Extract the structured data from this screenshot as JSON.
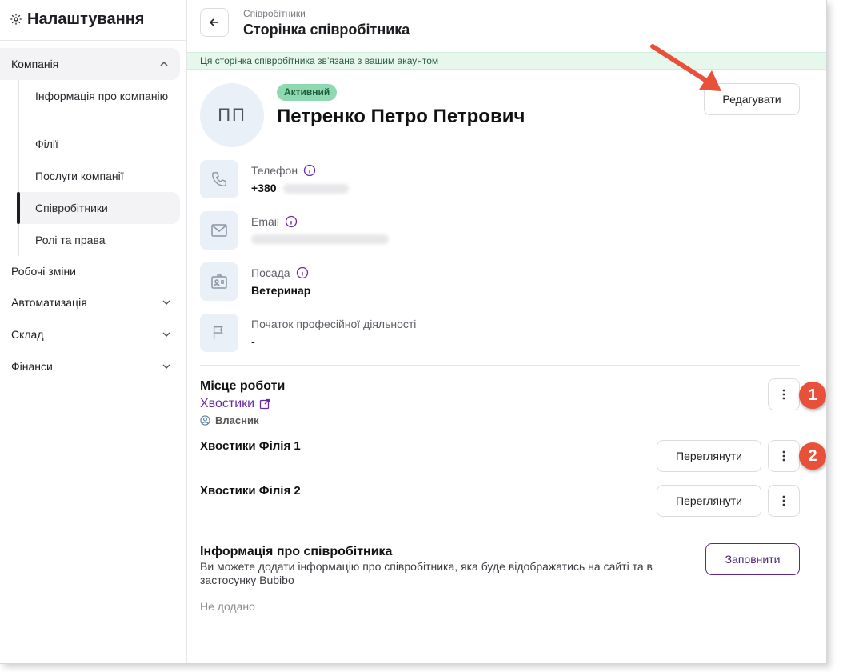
{
  "sidebar": {
    "title": "Налаштування",
    "company": "Компанія",
    "sub_items": [
      "Інформація про компанію",
      "Філії",
      "Послуги компанії",
      "Співробітники",
      "Ролі та права"
    ],
    "items": [
      "Робочі зміни",
      "Автоматизація",
      "Склад",
      "Фінанси"
    ]
  },
  "header": {
    "breadcrumb": "Співробітники",
    "title": "Сторінка співробітника"
  },
  "notice": "Ця сторінка співробітника зв’язана з вашим акаунтом",
  "employee": {
    "initials": "ПП",
    "status": "Активний",
    "name": "Петренко Петро Петрович",
    "edit_label": "Редагувати",
    "fields": [
      {
        "label": "Телефон",
        "value": "+380",
        "icon": "phone-icon"
      },
      {
        "label": "Email",
        "value": "",
        "icon": "mail-icon"
      },
      {
        "label": "Посада",
        "value": "Ветеринар",
        "icon": "badge-icon"
      },
      {
        "label": "Початок професійної діяльності",
        "value": "-",
        "icon": "flag-icon"
      }
    ]
  },
  "workplace": {
    "title": "Місце роботи",
    "company_link": "Хвостики",
    "role": "Власник",
    "branches": [
      {
        "name": "Хвостики Філія 1",
        "view_label": "Переглянути"
      },
      {
        "name": "Хвостики Філія 2",
        "view_label": "Переглянути"
      }
    ]
  },
  "employee_info": {
    "title": "Інформація про співробітника",
    "description": "Ви можете додати інформацію про співробітника, яка буде відображатись на сайті та в застосунку Bubibo",
    "fill_label": "Заповнити",
    "empty_text": "Не додано"
  },
  "annotations": {
    "step1": "1",
    "step2": "2",
    "accent": "#e8503a"
  }
}
